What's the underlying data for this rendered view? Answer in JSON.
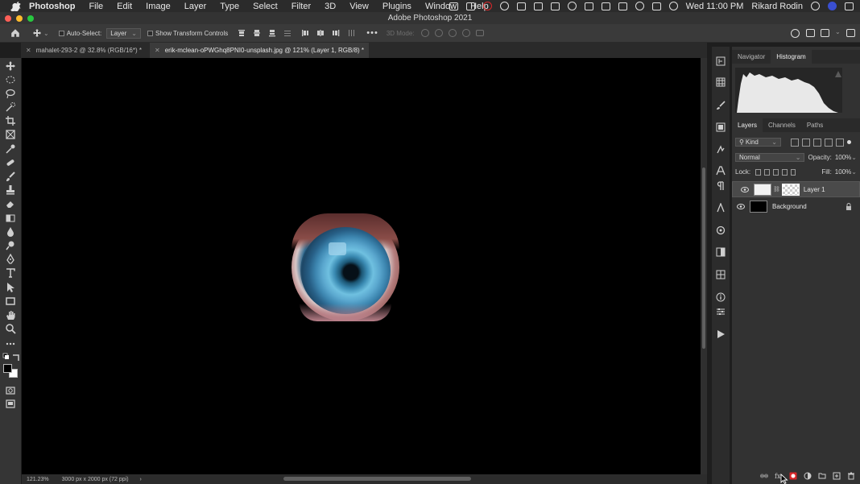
{
  "menubar": {
    "app_name": "Photoshop",
    "items": [
      "File",
      "Edit",
      "Image",
      "Layer",
      "Type",
      "Select",
      "Filter",
      "3D",
      "View",
      "Plugins",
      "Window",
      "Help"
    ],
    "clock": "Wed 11:00 PM",
    "user": "Rikard Rodin",
    "status_icons": [
      "spotlight-icon",
      "control-center-icon",
      "wifi-icon",
      "bluetooth-icon",
      "volume-icon",
      "time-machine-icon",
      "screen-icon"
    ]
  },
  "window": {
    "title": "Adobe Photoshop 2021"
  },
  "optionsbar": {
    "auto_select_label": "Auto-Select:",
    "auto_select_target": "Layer",
    "show_transform_label": "Show Transform Controls",
    "mode_3d_label": "3D Mode:"
  },
  "tabs": [
    {
      "label": "mahalet-293-2 @ 32.8% (RGB/16*) *",
      "active": false
    },
    {
      "label": "erik-mclean-oPWGhq8PNI0-unsplash.jpg @ 121% (Layer 1, RGB/8) *",
      "active": true
    }
  ],
  "status": {
    "zoom": "121.23%",
    "doc_size": "3000 px x 2000 px (72 ppi)"
  },
  "panels": {
    "top_tabs": [
      "Navigator",
      "Histogram"
    ],
    "top_active": "Histogram",
    "layer_tabs": [
      "Layers",
      "Channels",
      "Paths"
    ],
    "layer_active": "Layers",
    "filter_kind": "Kind",
    "blend_mode": "Normal",
    "opacity_label": "Opacity:",
    "opacity_value": "100%",
    "lock_label": "Lock:",
    "fill_label": "Fill:",
    "fill_value": "100%",
    "layers": [
      {
        "name": "Layer 1",
        "visible": true,
        "selected": true,
        "has_mask": true,
        "locked": false
      },
      {
        "name": "Background",
        "visible": true,
        "selected": false,
        "has_mask": false,
        "locked": true
      }
    ]
  },
  "colors": {
    "accent_red": "#d7272a",
    "canvas": "#000000",
    "panel": "#323232"
  }
}
